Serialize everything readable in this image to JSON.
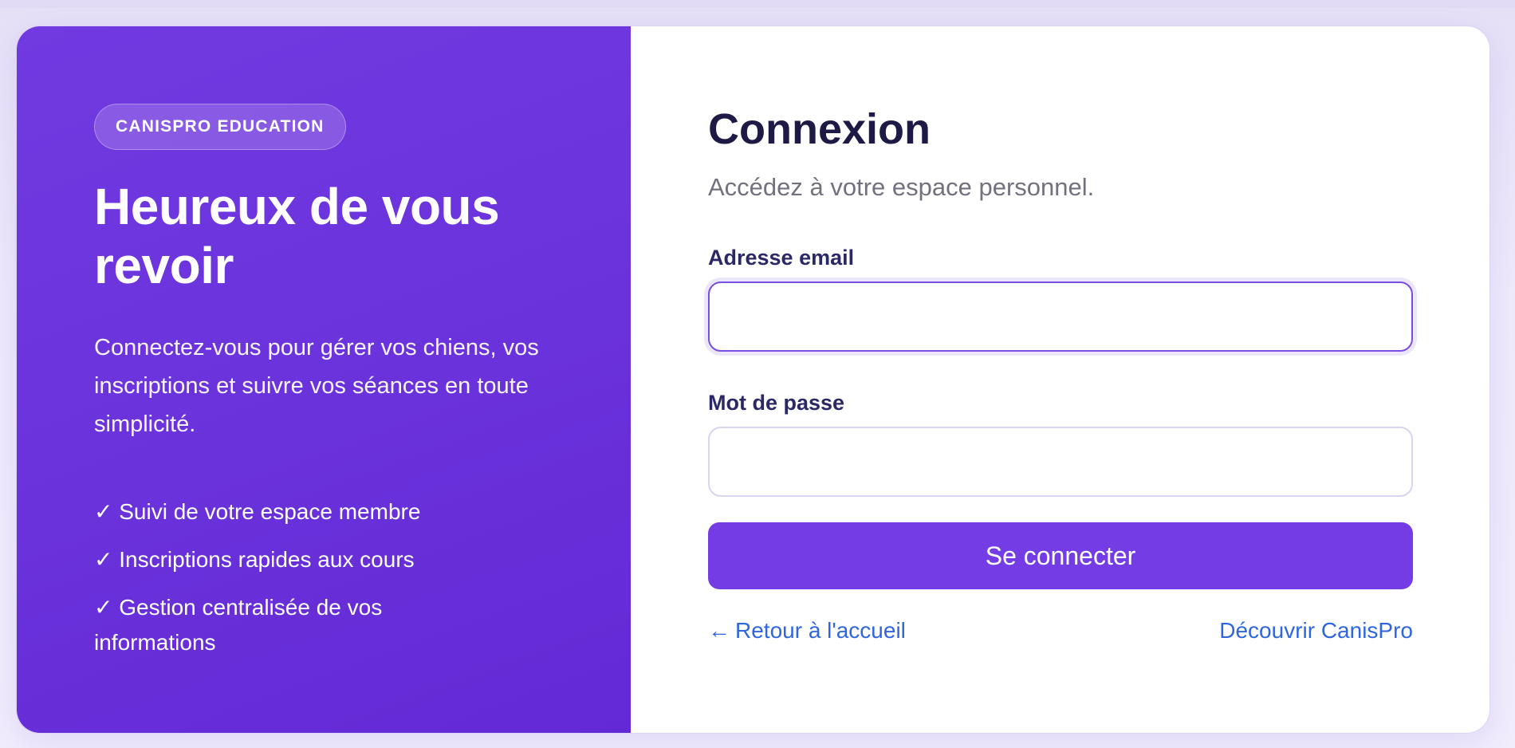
{
  "brand": {
    "badge": "CANISPRO EDUCATION"
  },
  "hero": {
    "title": "Heureux de vous revoir",
    "description": "Connectez-vous pour gérer vos chiens, vos inscriptions et suivre vos séances en toute simplicité.",
    "features": [
      "✓ Suivi de votre espace membre",
      "✓ Inscriptions rapides aux cours",
      "✓ Gestion centralisée de vos informations"
    ]
  },
  "form": {
    "title": "Connexion",
    "subtitle": "Accédez à votre espace personnel.",
    "email_label": "Adresse email",
    "email_value": "",
    "password_label": "Mot de passe",
    "password_value": "",
    "submit_label": "Se connecter"
  },
  "links": {
    "back_arrow": "←",
    "back_label": "Retour à l'accueil",
    "discover_label": "Découvrir CanisPro"
  },
  "colors": {
    "accent": "#743ce4",
    "panel": "#6a32db",
    "link": "#2f66e0",
    "heading": "#1d1a45"
  },
  "icons": {
    "back": "arrow-left-icon"
  }
}
